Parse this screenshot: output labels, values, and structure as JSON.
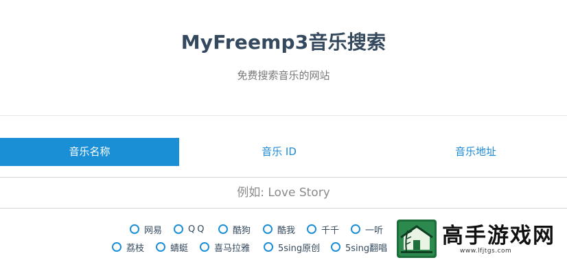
{
  "header": {
    "title": "MyFreemp3音乐搜索",
    "subtitle": "免费搜索音乐的网站"
  },
  "tabs": [
    {
      "label": "音乐名称",
      "active": true
    },
    {
      "label": "音乐 ID",
      "active": false
    },
    {
      "label": "音乐地址",
      "active": false
    }
  ],
  "search": {
    "placeholder": "例如: Love Story",
    "value": ""
  },
  "sources": {
    "row1": [
      "网易",
      "QQ",
      "酷狗",
      "酷我",
      "千千",
      "一听"
    ],
    "row2": [
      "荔枝",
      "蜻蜓",
      "喜马拉雅",
      "5sing原创",
      "5sing翻唱"
    ]
  },
  "watermark": {
    "title": "高手游戏网",
    "url": "www.lfjtgs.com",
    "logo_icon": "bamboo-house-logo"
  },
  "colors": {
    "accent": "#1a8fd6",
    "text": "#34495e",
    "muted": "#777777"
  }
}
